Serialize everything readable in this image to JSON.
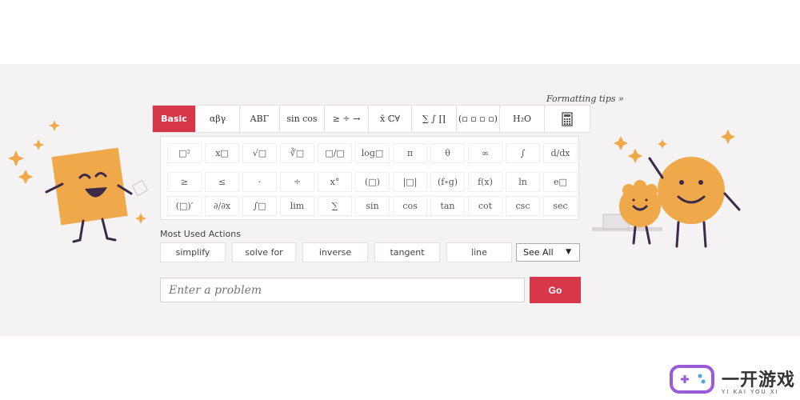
{
  "formatting_tips": "Formatting tips »",
  "tabs": [
    {
      "label": "Basic",
      "active": true
    },
    {
      "label": "αβγ"
    },
    {
      "label": "ΑΒΓ"
    },
    {
      "label": "sin cos"
    },
    {
      "label": "≥ ÷ →"
    },
    {
      "label": "x̄ ℂ∀"
    },
    {
      "label": "∑ ∫ ∏"
    },
    {
      "label": "(▫ ▫ ▫ ▫)"
    },
    {
      "label": "H₂O"
    },
    {
      "label": "calculator-icon"
    }
  ],
  "keypad": {
    "row1": [
      "□²",
      "x□",
      "√□",
      "∛□",
      "□/□",
      "log□",
      "π",
      "θ",
      "∞",
      "∫",
      "d/dx"
    ],
    "row2": [
      "≥",
      "≤",
      "·",
      "÷",
      "x°",
      "(□)",
      "|□|",
      "(f∘g)",
      "f(x)",
      "ln",
      "e□"
    ],
    "row3": [
      "(□)′",
      "∂/∂x",
      "∫□",
      "lim",
      "∑",
      "sin",
      "cos",
      "tan",
      "cot",
      "csc",
      "sec"
    ]
  },
  "most_used": {
    "label": "Most Used Actions",
    "actions": [
      "simplify",
      "solve for",
      "inverse",
      "tangent",
      "line"
    ],
    "see_all": "See All"
  },
  "input": {
    "placeholder": "Enter a problem"
  },
  "go_label": "Go",
  "watermark": {
    "title": "一开游戏",
    "subtitle": "YI KAI YOU XI"
  },
  "colors": {
    "accent": "#d6384a",
    "band": "#f4f2f3",
    "mascot": "#f0a94a",
    "outline": "#3b2a4a"
  }
}
